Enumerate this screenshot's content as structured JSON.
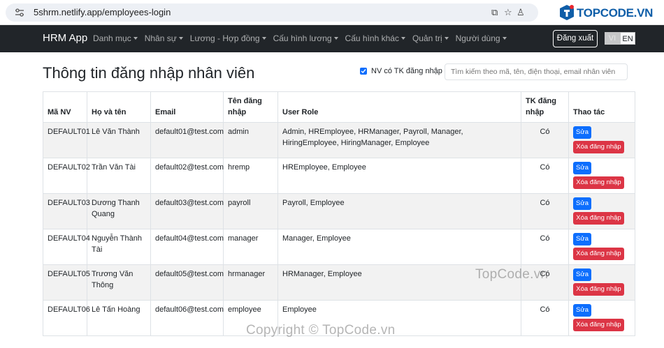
{
  "browser": {
    "url": "5shrm.netlify.app/employees-login",
    "brand_logo_text": "TOPCODE.VN"
  },
  "navbar": {
    "brand": "HRM App",
    "menu": [
      {
        "label": "Danh mục"
      },
      {
        "label": "Nhân sự"
      },
      {
        "label": "Lương - Hợp đồng"
      },
      {
        "label": "Cấu hình lương"
      },
      {
        "label": "Cấu hình khác"
      },
      {
        "label": "Quản trị"
      },
      {
        "label": "Người dùng"
      }
    ],
    "logout_label": "Đăng xuất",
    "lang": {
      "vi": "VI",
      "en": "EN",
      "active": "EN"
    }
  },
  "page": {
    "title": "Thông tin đăng nhập nhân viên",
    "filter_label": "NV có TK đăng nhập",
    "filter_checked": true,
    "search_placeholder": "Tìm kiếm theo mã, tên, điện thoại, email nhân viên"
  },
  "table": {
    "headers": [
      "Mã NV",
      "Họ và tên",
      "Email",
      "Tên đăng nhập",
      "User Role",
      "TK đăng nhập",
      "Thao tác"
    ],
    "edit_label": "Sửa",
    "delete_label": "Xóa đăng nhập",
    "rows": [
      {
        "code": "DEFAULT01",
        "name": "Lê Văn Thành",
        "email": "default01@test.com",
        "username": "admin",
        "roles": "Admin, HREmployee, HRManager, Payroll, Manager, HiringEmployee, HiringManager, Employee",
        "has_login": "Có"
      },
      {
        "code": "DEFAULT02",
        "name": "Trần Văn Tài",
        "email": "default02@test.com",
        "username": "hremp",
        "roles": "HREmployee, Employee",
        "has_login": "Có"
      },
      {
        "code": "DEFAULT03",
        "name": "Dương Thanh Quang",
        "email": "default03@test.com",
        "username": "payroll",
        "roles": "Payroll, Employee",
        "has_login": "Có"
      },
      {
        "code": "DEFAULT04",
        "name": "Nguyễn Thành Tài",
        "email": "default04@test.com",
        "username": "manager",
        "roles": "Manager, Employee",
        "has_login": "Có"
      },
      {
        "code": "DEFAULT05",
        "name": "Trương Văn Thông",
        "email": "default05@test.com",
        "username": "hrmanager",
        "roles": "HRManager, Employee",
        "has_login": "Có"
      },
      {
        "code": "DEFAULT06",
        "name": "Lê Tấn Hoàng",
        "email": "default06@test.com",
        "username": "employee",
        "roles": "Employee",
        "has_login": "Có"
      }
    ]
  },
  "watermarks": {
    "mid": "TopCode.vn",
    "bottom": "Copyright © TopCode.vn"
  },
  "colors": {
    "navbar_bg": "#212529",
    "primary": "#0d6efd",
    "danger": "#dc3545",
    "stripe": "#f2f2f2"
  }
}
